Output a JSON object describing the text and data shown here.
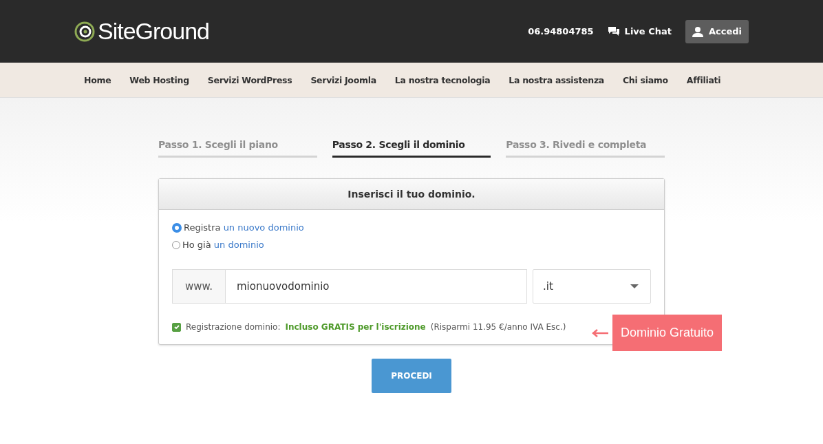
{
  "header": {
    "logo_text": "SiteGround",
    "phone": "06.94804785",
    "chat_label": "Live Chat",
    "login_button": "Accedi"
  },
  "nav": [
    {
      "label": "Home"
    },
    {
      "label": "Web Hosting"
    },
    {
      "label": "Servizi WordPress"
    },
    {
      "label": "Servizi Joomla"
    },
    {
      "label": "La nostra tecnologia"
    },
    {
      "label": "La nostra assistenza"
    },
    {
      "label": "Chi siamo"
    },
    {
      "label": "Affiliati"
    }
  ],
  "steps": [
    {
      "label": "Passo 1. Scegli il piano",
      "selected": false
    },
    {
      "label": "Passo 2. Scegli il dominio",
      "selected": true
    },
    {
      "label": "Passo 3. Rivedi e completa",
      "selected": false
    }
  ],
  "card": {
    "title": "Inserisci il tuo dominio.",
    "options": [
      {
        "text": "Registra",
        "link": "un nuovo dominio",
        "selected": true
      },
      {
        "text": "Ho già",
        "link": "un dominio",
        "selected": false
      }
    ],
    "prefix": "www.",
    "domain_value": "mionuovodominio",
    "tld": ".it",
    "registration": {
      "checked": true,
      "label": "Registrazione dominio:",
      "highlight": "Incluso GRATIS per l'iscrizione",
      "note": "(Risparmi 11.95 €/anno IVA Esc.)"
    }
  },
  "callout": "Dominio Gratuito",
  "submit_button": "PROCEDI"
}
